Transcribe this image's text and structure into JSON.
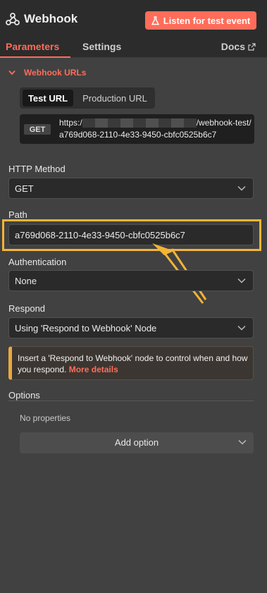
{
  "header": {
    "title": "Webhook",
    "listen_button": "Listen for test event",
    "logo_icon": "webhook-icon",
    "flask_icon": "flask-icon"
  },
  "tabs": {
    "parameters": "Parameters",
    "settings": "Settings",
    "docs": "Docs"
  },
  "webhook_urls": {
    "section_title": "Webhook URLs",
    "test_url_tab": "Test URL",
    "production_url_tab": "Production URL",
    "method_badge": "GET",
    "url_prefix": "https:/",
    "url_suffix": "/webhook-test/a769d068-2110-4e33-9450-cbfc0525b6c7"
  },
  "http_method": {
    "label": "HTTP Method",
    "value": "GET"
  },
  "path": {
    "label": "Path",
    "value": "a769d068-2110-4e33-9450-cbfc0525b6c7"
  },
  "authentication": {
    "label": "Authentication",
    "value": "None"
  },
  "respond": {
    "label": "Respond",
    "value": "Using 'Respond to Webhook' Node"
  },
  "notice": {
    "text": "Insert a 'Respond to Webhook' node to control when and how you respond.",
    "link": "More details"
  },
  "options": {
    "label": "Options",
    "empty": "No properties",
    "add_button": "Add option"
  },
  "colors": {
    "accent": "#ff6d5a",
    "highlight": "#f4b436",
    "warning": "#e8a840"
  }
}
